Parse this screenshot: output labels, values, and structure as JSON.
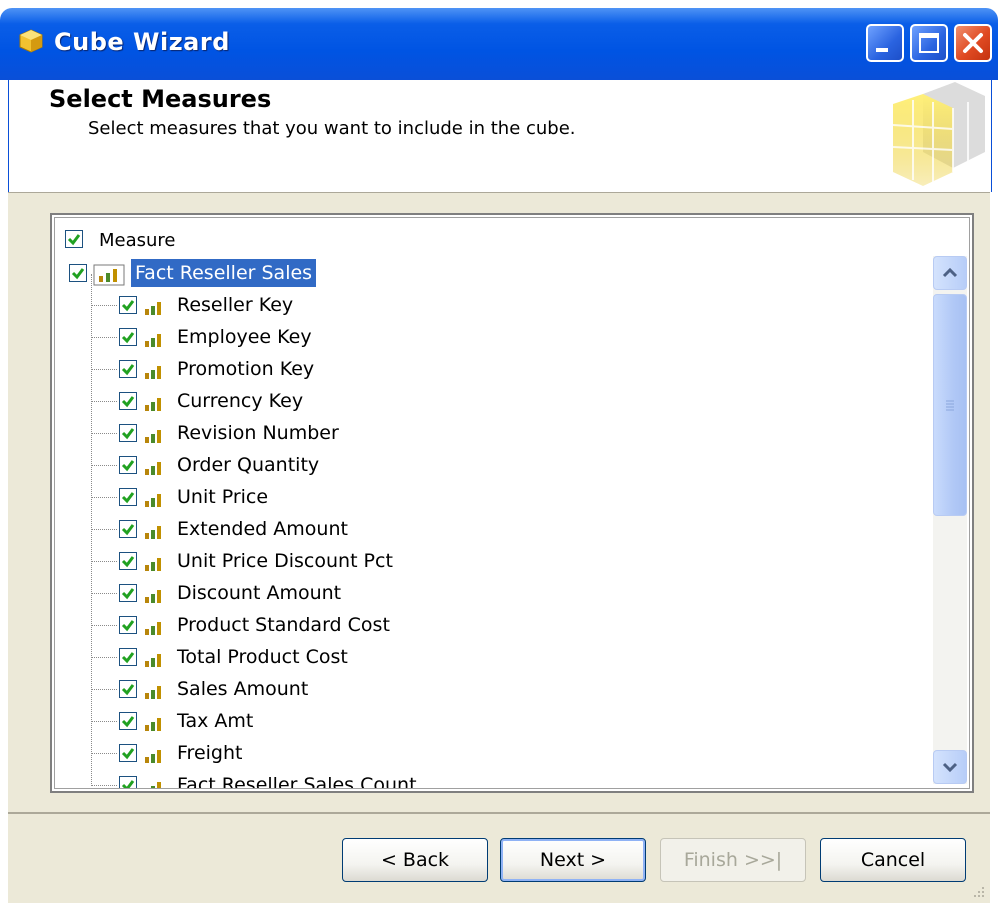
{
  "window": {
    "title": "Cube Wizard"
  },
  "header": {
    "title": "Select Measures",
    "subtitle": "Select measures that you want to include in the cube."
  },
  "list": {
    "column_header": "Measure",
    "root": "Fact Reseller Sales",
    "items": [
      "Reseller Key",
      "Employee Key",
      "Promotion Key",
      "Currency Key",
      "Revision Number",
      "Order Quantity",
      "Unit Price",
      "Extended Amount",
      "Unit Price Discount Pct",
      "Discount Amount",
      "Product Standard Cost",
      "Total Product Cost",
      "Sales Amount",
      "Tax Amt",
      "Freight",
      "Fact Reseller Sales Count"
    ]
  },
  "buttons": {
    "back": "< Back",
    "next": "Next >",
    "finish": "Finish >>|",
    "cancel": "Cancel"
  },
  "colors": {
    "titlebar": "#0054e3",
    "selection": "#316ac5",
    "check": "#21a121"
  }
}
